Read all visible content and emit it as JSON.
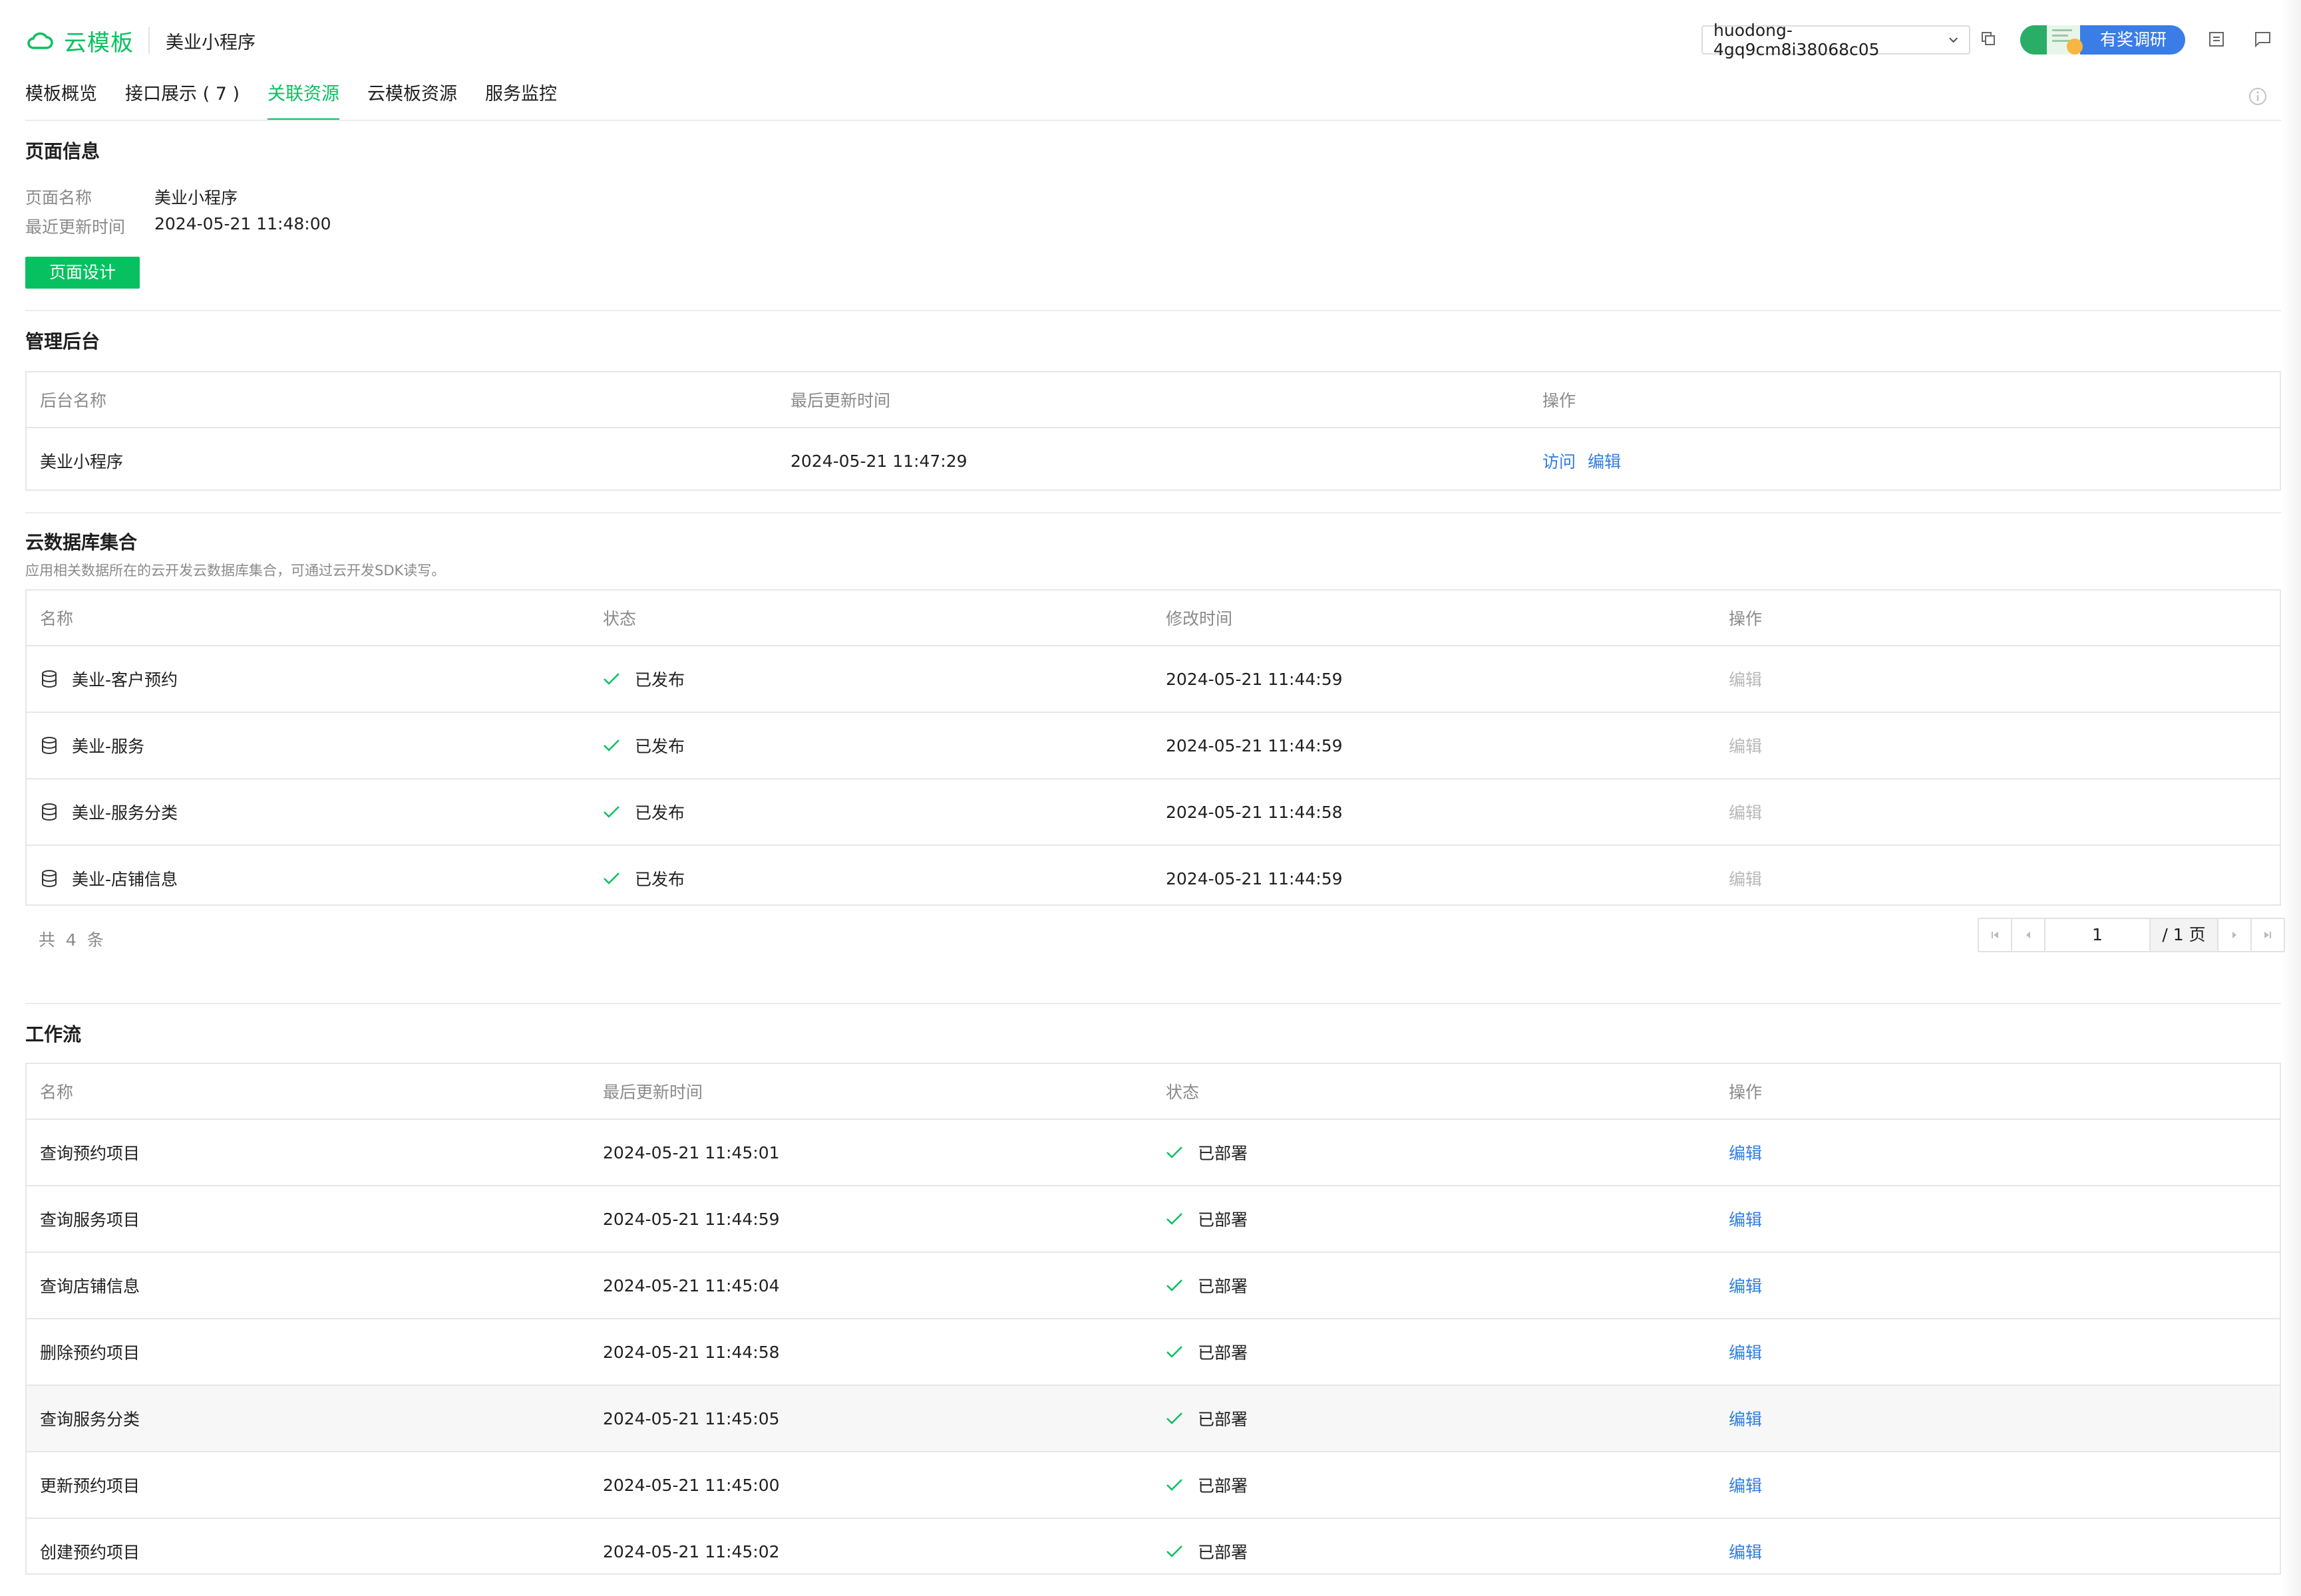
{
  "header": {
    "logo_text": "云模板",
    "app_name": "美业小程序",
    "env_id": "huodong-4gq9cm8i38068c05",
    "survey_label": "有奖调研",
    "icons": [
      "cloud-logo-icon",
      "chevron-down-icon",
      "copy-icon",
      "document-icon",
      "feedback-icon",
      "info-icon"
    ]
  },
  "tabs": [
    {
      "label": "模板概览"
    },
    {
      "label": "接口展示 ( 7 )"
    },
    {
      "label": "关联资源",
      "active": true
    },
    {
      "label": "云模板资源"
    },
    {
      "label": "服务监控"
    }
  ],
  "page_info": {
    "title": "页面信息",
    "name_label": "页面名称",
    "name_value": "美业小程序",
    "updated_label": "最近更新时间",
    "updated_value": "2024-05-21 11:48:00",
    "design_button": "页面设计"
  },
  "admin": {
    "title": "管理后台",
    "columns": [
      "后台名称",
      "最后更新时间",
      "操作"
    ],
    "row": {
      "name": "美业小程序",
      "updated": "2024-05-21 11:47:29",
      "visit": "访问",
      "edit": "编辑"
    }
  },
  "database": {
    "title": "云数据库集合",
    "subtitle": "应用相关数据所在的云开发云数据库集合，可通过云开发SDK读写。",
    "columns": [
      "名称",
      "状态",
      "修改时间",
      "操作"
    ],
    "rows": [
      {
        "name": "美业-客户预约",
        "status": "已发布",
        "time": "2024-05-21 11:44:59",
        "op": "编辑"
      },
      {
        "name": "美业-服务",
        "status": "已发布",
        "time": "2024-05-21 11:44:59",
        "op": "编辑"
      },
      {
        "name": "美业-服务分类",
        "status": "已发布",
        "time": "2024-05-21 11:44:58",
        "op": "编辑"
      },
      {
        "name": "美业-店铺信息",
        "status": "已发布",
        "time": "2024-05-21 11:44:59",
        "op": "编辑"
      }
    ],
    "total": "共  4  条",
    "page_current": "1",
    "page_total": "/ 1 页"
  },
  "workflow": {
    "title": "工作流",
    "columns": [
      "名称",
      "最后更新时间",
      "状态",
      "操作"
    ],
    "rows": [
      {
        "name": "查询预约项目",
        "time": "2024-05-21 11:45:01",
        "status": "已部署",
        "op": "编辑"
      },
      {
        "name": "查询服务项目",
        "time": "2024-05-21 11:44:59",
        "status": "已部署",
        "op": "编辑"
      },
      {
        "name": "查询店铺信息",
        "time": "2024-05-21 11:45:04",
        "status": "已部署",
        "op": "编辑"
      },
      {
        "name": "删除预约项目",
        "time": "2024-05-21 11:44:58",
        "status": "已部署",
        "op": "编辑"
      },
      {
        "name": "查询服务分类",
        "time": "2024-05-21 11:45:05",
        "status": "已部署",
        "op": "编辑"
      },
      {
        "name": "更新预约项目",
        "time": "2024-05-21 11:45:00",
        "status": "已部署",
        "op": "编辑"
      },
      {
        "name": "创建预约项目",
        "time": "2024-05-21 11:45:02",
        "status": "已部署",
        "op": "编辑"
      }
    ]
  },
  "colors": {
    "brand": "#07c160",
    "link": "#2f7de1",
    "survey": "#3a7de6"
  }
}
